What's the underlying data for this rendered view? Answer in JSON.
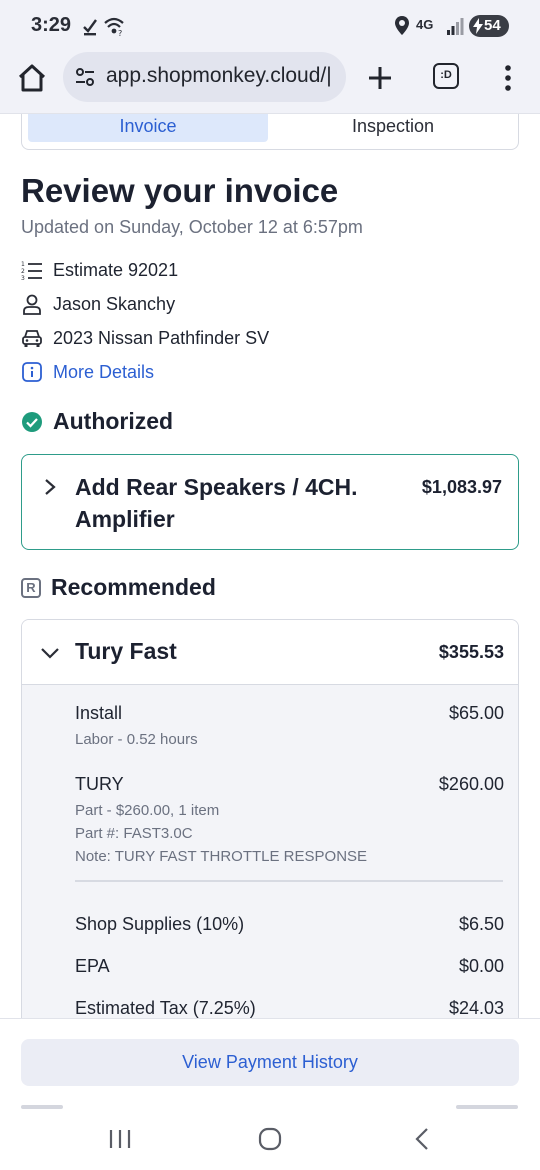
{
  "status_bar": {
    "time": "3:29",
    "battery": "54",
    "network": "4G"
  },
  "browser": {
    "url": "app.shopmonkey.cloud/|",
    "tabs_label": ":D"
  },
  "tabs": {
    "invoice": "Invoice",
    "inspection": "Inspection"
  },
  "page": {
    "title": "Review your invoice",
    "updated": "Updated on Sunday, October 12 at 6:57pm"
  },
  "details": {
    "estimate": "Estimate 92021",
    "customer": "Jason Skanchy",
    "vehicle": "2023 Nissan Pathfinder SV",
    "more_details": "More Details"
  },
  "authorized": {
    "heading": "Authorized",
    "service_title": "Add Rear Speakers / 4CH. Amplifier",
    "service_price": "$1,083.97"
  },
  "recommended": {
    "heading": "Recommended",
    "badge": "R",
    "service_title": "Tury Fast",
    "service_price": "$355.53",
    "items": [
      {
        "name": "Install",
        "price": "$65.00",
        "sub1": "Labor - 0.52 hours"
      },
      {
        "name": "TURY",
        "price": "$260.00",
        "sub1": "Part - $260.00, 1 item",
        "sub2": "Part #: FAST3.0C",
        "sub3": "Note: TURY FAST THROTTLE RESPONSE"
      }
    ],
    "fees": [
      {
        "name": "Shop Supplies (10%)",
        "price": "$6.50"
      },
      {
        "name": "EPA",
        "price": "$0.00"
      },
      {
        "name": "Estimated Tax (7.25%)",
        "price": "$24.03"
      }
    ]
  },
  "footer": {
    "payment_history": "View Payment History"
  },
  "colors": {
    "accent_blue": "#2c5fd2",
    "authorized_green": "#2e9c8a",
    "tab_active_bg": "#dde8fb"
  }
}
